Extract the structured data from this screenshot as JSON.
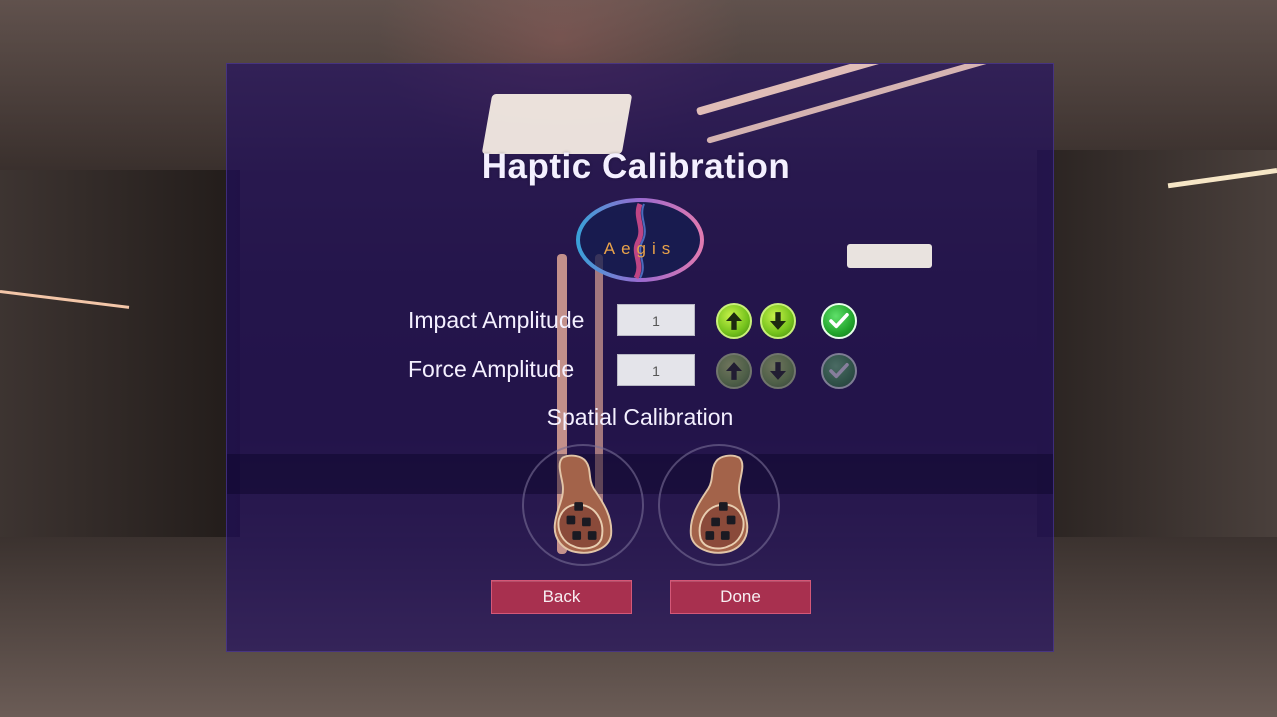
{
  "title": "Haptic Calibration",
  "logo": {
    "text": "Aegis",
    "icon": "aegis-logo-icon"
  },
  "rows": [
    {
      "label": "Impact Amplitude",
      "value": "1",
      "enabled": true
    },
    {
      "label": "Force Amplitude",
      "value": "1",
      "enabled": false
    }
  ],
  "section_label": "Spatial Calibration",
  "hands": [
    {
      "name": "left-hand-calibration",
      "icon": "hand-sensor-icon"
    },
    {
      "name": "right-hand-calibration",
      "icon": "hand-sensor-icon"
    }
  ],
  "buttons": {
    "back": "Back",
    "done": "Done"
  },
  "colors": {
    "panel": "#1e0c64",
    "button": "#a8304f",
    "up_down": "#74c21c",
    "check": "#22a52c"
  }
}
